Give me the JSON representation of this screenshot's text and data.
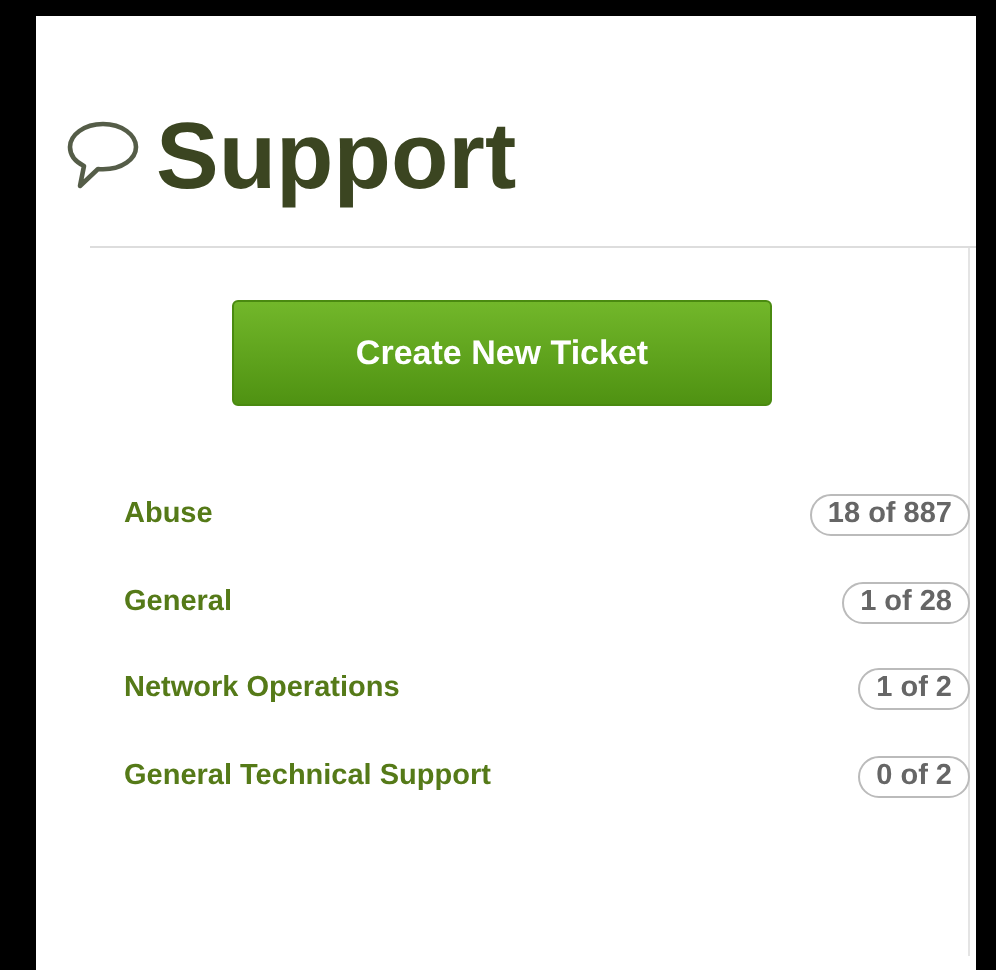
{
  "title": "Support",
  "button": "Create New Ticket",
  "departments": [
    {
      "name": "Abuse",
      "count": "18 of 887"
    },
    {
      "name": "General",
      "count": "1 of 28"
    },
    {
      "name": "Network Operations",
      "count": "1 of 2"
    },
    {
      "name": "General Technical Support",
      "count": "0 of 2"
    }
  ]
}
